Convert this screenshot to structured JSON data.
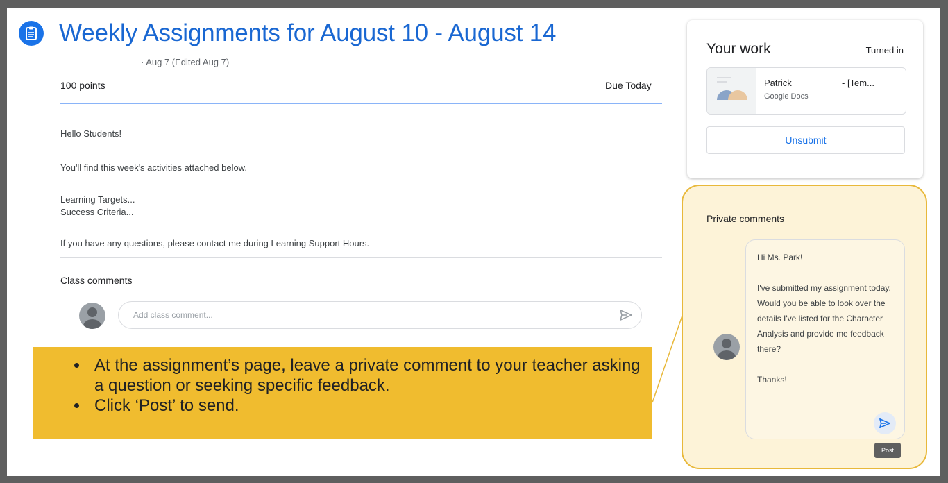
{
  "assignment": {
    "title": "Weekly Assignments for August 10 - August 14",
    "meta": "· Aug 7 (Edited Aug 7)",
    "points": "100 points",
    "due": "Due Today",
    "body": {
      "greeting": "Hello Students!",
      "intro": "You'll find this week's activities attached below.",
      "targets": "Learning Targets...",
      "criteria": "Success Criteria...",
      "questions": "If you have any questions, please contact me during Learning Support Hours."
    }
  },
  "class_comments": {
    "heading": "Class comments",
    "placeholder": "Add class comment..."
  },
  "callout": {
    "bullets": [
      "At the assignment’s page, leave a private comment to your teacher asking a question or seeking specific feedback.",
      "Click ‘Post’ to send."
    ]
  },
  "your_work": {
    "title": "Your work",
    "status": "Turned in",
    "file_name": "Patrick",
    "file_suffix": "- [Tem...",
    "file_type": "Google Docs",
    "unsubmit_label": "Unsubmit"
  },
  "private_comments": {
    "heading": "Private comments",
    "message": "Hi Ms. Park!\n\nI've submitted my assignment today.  Would you be able to look over the details I've listed for the Character Analysis and provide me feedback there?\n\nThanks!",
    "post_tooltip": "Post"
  },
  "colors": {
    "accent": "#1a73e8",
    "title_blue": "#1967d2",
    "callout_yellow": "#f0bc2f",
    "highlight_border": "#e8b83a"
  },
  "icons": [
    "assignment-icon",
    "avatar-icon",
    "send-icon",
    "doc-thumbnail-icon"
  ]
}
